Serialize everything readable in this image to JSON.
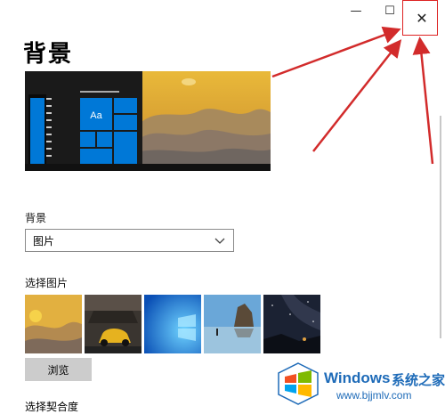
{
  "window": {
    "minimize_glyph": "—",
    "maximize_glyph": "☐",
    "close_glyph": "✕"
  },
  "page": {
    "title": "背景"
  },
  "preview": {
    "tile_text": "Aa",
    "accent_color": "#0078d7"
  },
  "background_section": {
    "label": "背景",
    "selected_value": "图片"
  },
  "choose_picture": {
    "label": "选择图片",
    "thumbnails": [
      "yellow-desert",
      "car-garage",
      "windows-blue",
      "beach-rocks",
      "night-sky"
    ]
  },
  "browse_button": {
    "label": "浏览"
  },
  "fit_section": {
    "label": "选择契合度"
  },
  "watermark": {
    "brand": "Windows",
    "cn_text": "系统之家",
    "url": "www.bjjmlv.com"
  },
  "annotation_color": "#d22b2b"
}
